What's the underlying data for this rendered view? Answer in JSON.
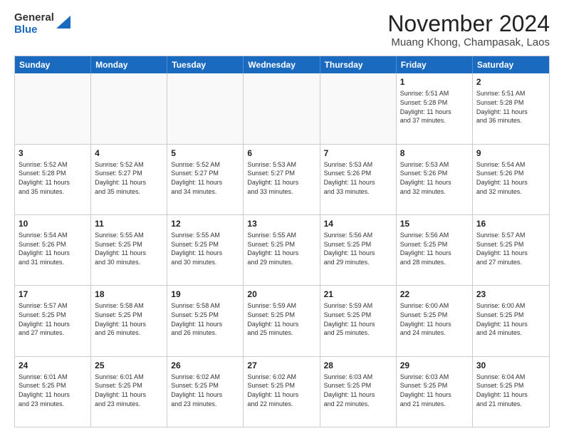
{
  "logo": {
    "line1": "General",
    "line2": "Blue"
  },
  "header": {
    "month": "November 2024",
    "location": "Muang Khong, Champasak, Laos"
  },
  "weekdays": [
    "Sunday",
    "Monday",
    "Tuesday",
    "Wednesday",
    "Thursday",
    "Friday",
    "Saturday"
  ],
  "weeks": [
    [
      {
        "day": "",
        "info": ""
      },
      {
        "day": "",
        "info": ""
      },
      {
        "day": "",
        "info": ""
      },
      {
        "day": "",
        "info": ""
      },
      {
        "day": "",
        "info": ""
      },
      {
        "day": "1",
        "info": "Sunrise: 5:51 AM\nSunset: 5:28 PM\nDaylight: 11 hours\nand 37 minutes."
      },
      {
        "day": "2",
        "info": "Sunrise: 5:51 AM\nSunset: 5:28 PM\nDaylight: 11 hours\nand 36 minutes."
      }
    ],
    [
      {
        "day": "3",
        "info": "Sunrise: 5:52 AM\nSunset: 5:28 PM\nDaylight: 11 hours\nand 35 minutes."
      },
      {
        "day": "4",
        "info": "Sunrise: 5:52 AM\nSunset: 5:27 PM\nDaylight: 11 hours\nand 35 minutes."
      },
      {
        "day": "5",
        "info": "Sunrise: 5:52 AM\nSunset: 5:27 PM\nDaylight: 11 hours\nand 34 minutes."
      },
      {
        "day": "6",
        "info": "Sunrise: 5:53 AM\nSunset: 5:27 PM\nDaylight: 11 hours\nand 33 minutes."
      },
      {
        "day": "7",
        "info": "Sunrise: 5:53 AM\nSunset: 5:26 PM\nDaylight: 11 hours\nand 33 minutes."
      },
      {
        "day": "8",
        "info": "Sunrise: 5:53 AM\nSunset: 5:26 PM\nDaylight: 11 hours\nand 32 minutes."
      },
      {
        "day": "9",
        "info": "Sunrise: 5:54 AM\nSunset: 5:26 PM\nDaylight: 11 hours\nand 32 minutes."
      }
    ],
    [
      {
        "day": "10",
        "info": "Sunrise: 5:54 AM\nSunset: 5:26 PM\nDaylight: 11 hours\nand 31 minutes."
      },
      {
        "day": "11",
        "info": "Sunrise: 5:55 AM\nSunset: 5:25 PM\nDaylight: 11 hours\nand 30 minutes."
      },
      {
        "day": "12",
        "info": "Sunrise: 5:55 AM\nSunset: 5:25 PM\nDaylight: 11 hours\nand 30 minutes."
      },
      {
        "day": "13",
        "info": "Sunrise: 5:55 AM\nSunset: 5:25 PM\nDaylight: 11 hours\nand 29 minutes."
      },
      {
        "day": "14",
        "info": "Sunrise: 5:56 AM\nSunset: 5:25 PM\nDaylight: 11 hours\nand 29 minutes."
      },
      {
        "day": "15",
        "info": "Sunrise: 5:56 AM\nSunset: 5:25 PM\nDaylight: 11 hours\nand 28 minutes."
      },
      {
        "day": "16",
        "info": "Sunrise: 5:57 AM\nSunset: 5:25 PM\nDaylight: 11 hours\nand 27 minutes."
      }
    ],
    [
      {
        "day": "17",
        "info": "Sunrise: 5:57 AM\nSunset: 5:25 PM\nDaylight: 11 hours\nand 27 minutes."
      },
      {
        "day": "18",
        "info": "Sunrise: 5:58 AM\nSunset: 5:25 PM\nDaylight: 11 hours\nand 26 minutes."
      },
      {
        "day": "19",
        "info": "Sunrise: 5:58 AM\nSunset: 5:25 PM\nDaylight: 11 hours\nand 26 minutes."
      },
      {
        "day": "20",
        "info": "Sunrise: 5:59 AM\nSunset: 5:25 PM\nDaylight: 11 hours\nand 25 minutes."
      },
      {
        "day": "21",
        "info": "Sunrise: 5:59 AM\nSunset: 5:25 PM\nDaylight: 11 hours\nand 25 minutes."
      },
      {
        "day": "22",
        "info": "Sunrise: 6:00 AM\nSunset: 5:25 PM\nDaylight: 11 hours\nand 24 minutes."
      },
      {
        "day": "23",
        "info": "Sunrise: 6:00 AM\nSunset: 5:25 PM\nDaylight: 11 hours\nand 24 minutes."
      }
    ],
    [
      {
        "day": "24",
        "info": "Sunrise: 6:01 AM\nSunset: 5:25 PM\nDaylight: 11 hours\nand 23 minutes."
      },
      {
        "day": "25",
        "info": "Sunrise: 6:01 AM\nSunset: 5:25 PM\nDaylight: 11 hours\nand 23 minutes."
      },
      {
        "day": "26",
        "info": "Sunrise: 6:02 AM\nSunset: 5:25 PM\nDaylight: 11 hours\nand 23 minutes."
      },
      {
        "day": "27",
        "info": "Sunrise: 6:02 AM\nSunset: 5:25 PM\nDaylight: 11 hours\nand 22 minutes."
      },
      {
        "day": "28",
        "info": "Sunrise: 6:03 AM\nSunset: 5:25 PM\nDaylight: 11 hours\nand 22 minutes."
      },
      {
        "day": "29",
        "info": "Sunrise: 6:03 AM\nSunset: 5:25 PM\nDaylight: 11 hours\nand 21 minutes."
      },
      {
        "day": "30",
        "info": "Sunrise: 6:04 AM\nSunset: 5:25 PM\nDaylight: 11 hours\nand 21 minutes."
      }
    ]
  ]
}
